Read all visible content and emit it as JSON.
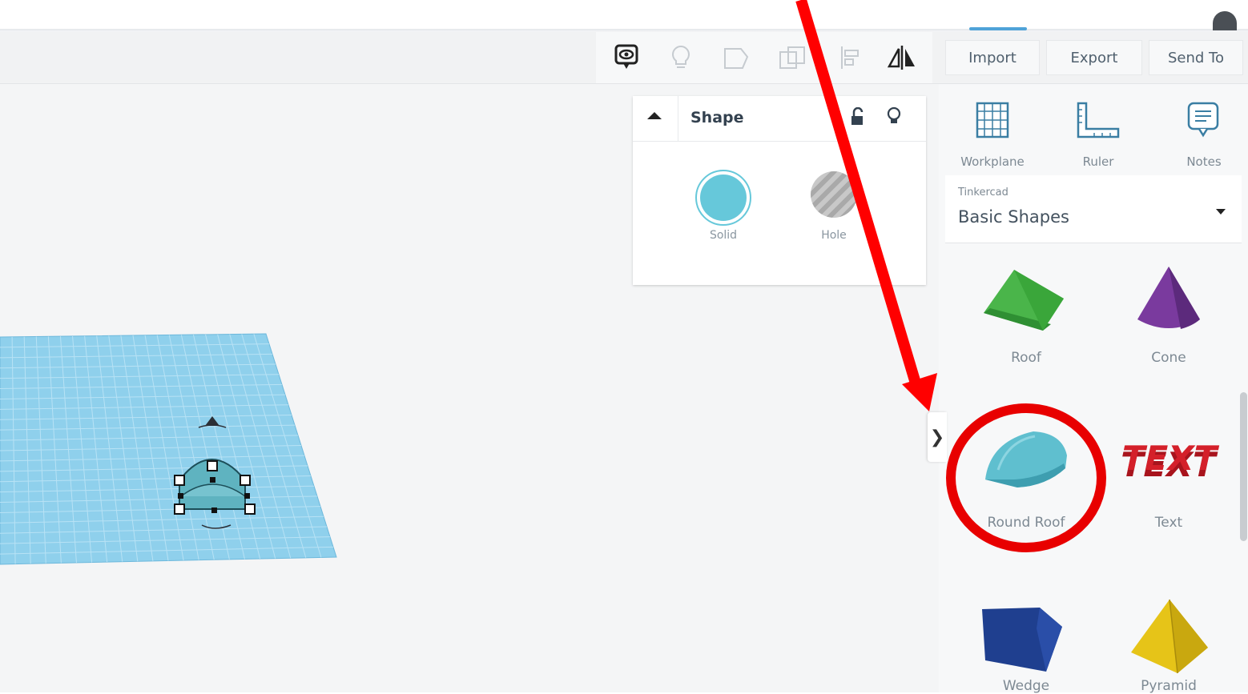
{
  "toolbar": {
    "import_label": "Import",
    "export_label": "Export",
    "send_to_label": "Send To",
    "icons": [
      "speech-eye-icon",
      "lightbulb-icon",
      "group-icon",
      "ungroup-icon",
      "align-icon",
      "mirror-icon"
    ]
  },
  "inspector": {
    "title": "Shape",
    "solid_label": "Solid",
    "hole_label": "Hole",
    "solid_color": "#66c8da"
  },
  "panel": {
    "tools": [
      {
        "label": "Workplane"
      },
      {
        "label": "Ruler"
      },
      {
        "label": "Notes"
      }
    ],
    "library": {
      "provider": "Tinkercad",
      "selected": "Basic Shapes"
    },
    "shapes": [
      {
        "label": "Roof",
        "color": "#3aa63a"
      },
      {
        "label": "Cone",
        "color": "#7a3a9e"
      },
      {
        "label": "Round Roof",
        "color": "#5fbfcf"
      },
      {
        "label": "Text",
        "color": "#d4202a",
        "glyph": "TEXT"
      },
      {
        "label": "Wedge",
        "color": "#1f3f8f"
      },
      {
        "label": "Pyramid",
        "color": "#e6c418"
      }
    ]
  },
  "annotation": {
    "arrow_color": "#ff0000",
    "circle_color": "#e80000"
  }
}
